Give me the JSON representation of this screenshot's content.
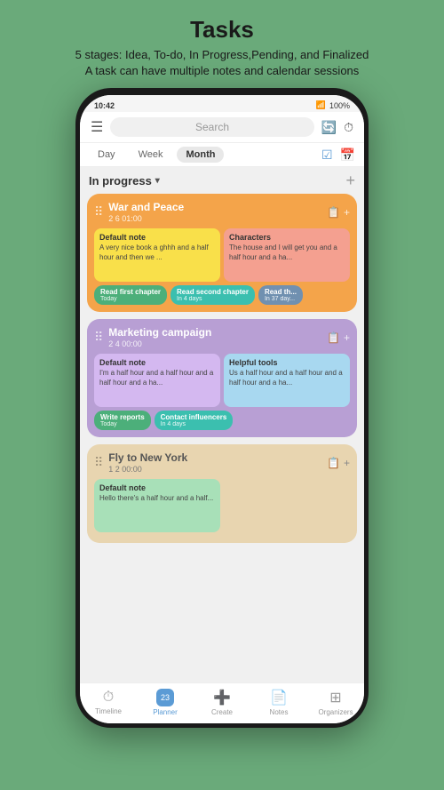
{
  "page": {
    "title": "Tasks",
    "subtitle_line1": "5 stages: Idea, To-do, In Progress,Pending, and Finalized",
    "subtitle_line2": "A task can have multiple notes and calendar sessions"
  },
  "status_bar": {
    "time": "10:42",
    "battery": "100%"
  },
  "top_bar": {
    "search_placeholder": "Search"
  },
  "tabs": [
    {
      "label": "Day",
      "active": false
    },
    {
      "label": "Week",
      "active": false
    },
    {
      "label": "Month",
      "active": true
    }
  ],
  "section": {
    "title": "In progress",
    "add_label": "+"
  },
  "tasks": [
    {
      "id": "war-and-peace",
      "title": "War and Peace",
      "meta": "2  6  01:00",
      "color": "orange",
      "notes": [
        {
          "id": "default-note-1",
          "title": "Default note",
          "text": "A very nice book a ghhh and a half hour and then we ...",
          "color": "yellow"
        },
        {
          "id": "characters",
          "title": "Characters",
          "text": "The house and I will get you and a half hour and a ha...",
          "color": "salmon"
        }
      ],
      "sessions": [
        {
          "id": "read-first",
          "label": "Read first chapter",
          "date": "Today",
          "color": "green"
        },
        {
          "id": "read-second",
          "label": "Read second chapter",
          "date": "In 4 days",
          "color": "teal"
        },
        {
          "id": "read-third",
          "label": "Read th...",
          "date": "In 37 day...",
          "color": "blue-grey"
        }
      ]
    },
    {
      "id": "marketing-campaign",
      "title": "Marketing campaign",
      "meta": "2  4  00:00",
      "color": "purple",
      "notes": [
        {
          "id": "default-note-2",
          "title": "Default note",
          "text": "I'm a half hour and a half hour and a half hour and a ha...",
          "color": "light-purple"
        },
        {
          "id": "helpful-tools",
          "title": "Helpful tools",
          "text": "Us a half hour and a half hour and a half hour and a ha...",
          "color": "light-blue"
        }
      ],
      "sessions": [
        {
          "id": "write-reports",
          "label": "Write reports",
          "date": "Today",
          "color": "green"
        },
        {
          "id": "contact-influencers",
          "label": "Contact influencers",
          "date": "In 4 days",
          "color": "teal"
        }
      ]
    },
    {
      "id": "fly-to-new-york",
      "title": "Fly to New York",
      "meta": "1  2  00:00",
      "color": "beige",
      "notes": [
        {
          "id": "default-note-3",
          "title": "Default note",
          "text": "Hello there's a half hour and a half...",
          "color": "light-green"
        }
      ],
      "sessions": []
    }
  ],
  "bottom_nav": [
    {
      "id": "timeline",
      "label": "Timeline",
      "icon": "⏱",
      "active": false
    },
    {
      "id": "planner",
      "label": "Planner",
      "icon": "📅",
      "active": true
    },
    {
      "id": "create",
      "label": "Create",
      "icon": "➕",
      "active": false
    },
    {
      "id": "notes",
      "label": "Notes",
      "icon": "📄",
      "active": false
    },
    {
      "id": "organizers",
      "label": "Organizers",
      "icon": "⊞",
      "active": false
    }
  ]
}
